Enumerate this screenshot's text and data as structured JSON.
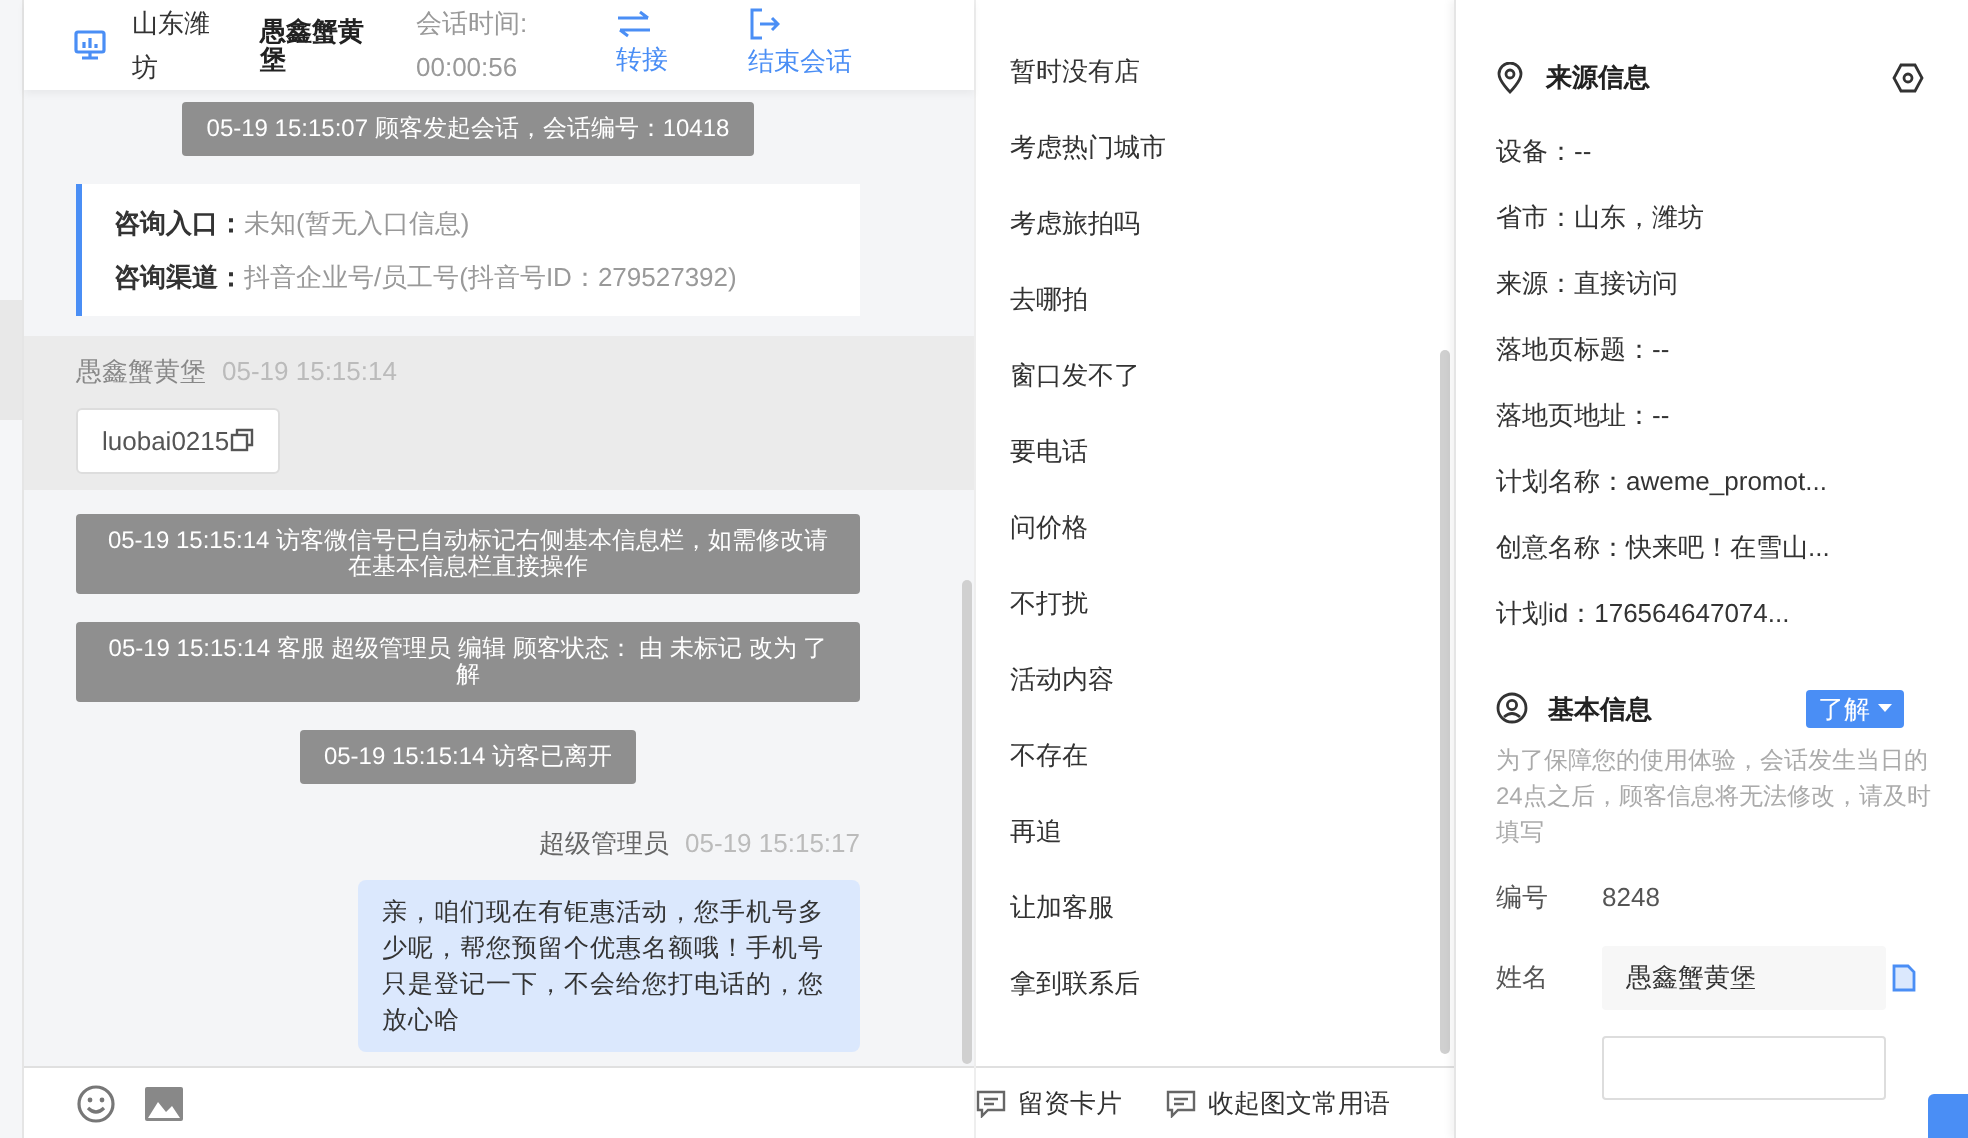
{
  "header": {
    "location": "山东潍坊",
    "customer": "愚鑫蟹黄堡",
    "timer_label": "会话时间:",
    "timer": "00:00:56",
    "actions": [
      {
        "label": "转接",
        "kind": "transfer"
      },
      {
        "label": "结束会话",
        "kind": "end"
      }
    ]
  },
  "messages": [
    {
      "kind": "system",
      "text": "05-19 15:15:07 顾客发起会话，会话编号：10418"
    },
    {
      "kind": "entry",
      "fields": [
        {
          "label": "咨询入口：",
          "value": "未知(暂无入口信息)"
        },
        {
          "label": "咨询渠道：",
          "value": "抖音企业号/员工号(抖音号ID：279527392)"
        }
      ]
    },
    {
      "kind": "visitor",
      "sender": "愚鑫蟹黄堡",
      "time": "05-19 15:15:14",
      "text": "luobai0215"
    },
    {
      "kind": "system",
      "text": "05-19 15:15:14 访客微信号已自动标记右侧基本信息栏，如需修改请在基本信息栏直接操作"
    },
    {
      "kind": "system",
      "text": "05-19 15:15:14 客服 超级管理员 编辑 顾客状态： 由 未标记 改为 了解"
    },
    {
      "kind": "system",
      "text": "05-19 15:15:14 访客已离开"
    },
    {
      "kind": "agent",
      "sender": "超级管理员",
      "time": "05-19 15:15:17",
      "text": "亲，咱们现在有钜惠活动，您手机号多少呢，帮您预留个优惠名额哦！手机号只是登记一下，不会给您打电话的，您放心哈"
    }
  ],
  "bottom_actions": [
    {
      "label": "留资卡片"
    },
    {
      "label": "收起图文常用语"
    }
  ],
  "quick_replies": [
    "暂时没有店",
    "考虑热门城市",
    "考虑旅拍吗",
    "去哪拍",
    "窗口发不了",
    "要电话",
    "问价格",
    "不打扰",
    "活动内容",
    "不存在",
    "再追",
    "让加客服",
    "拿到联系后"
  ],
  "source_info": {
    "title": "来源信息",
    "items": [
      "设备：--",
      "省市：山东，潍坊",
      "来源：直接访问",
      "落地页标题：--",
      "落地页地址：--",
      "计划名称：aweme_promot...",
      "创意名称：快来吧！在雪山...",
      "计划id：176564647074..."
    ]
  },
  "basic_info": {
    "title": "基本信息",
    "status": "了解",
    "notice": "为了保障您的使用体验，会话发生当日的24点之后，顾客信息将无法修改，请及时填写",
    "fields": [
      {
        "label": "编号",
        "value": "8248",
        "kind": "text"
      },
      {
        "label": "姓名",
        "value": "愚鑫蟹黄堡",
        "kind": "input"
      }
    ]
  }
}
